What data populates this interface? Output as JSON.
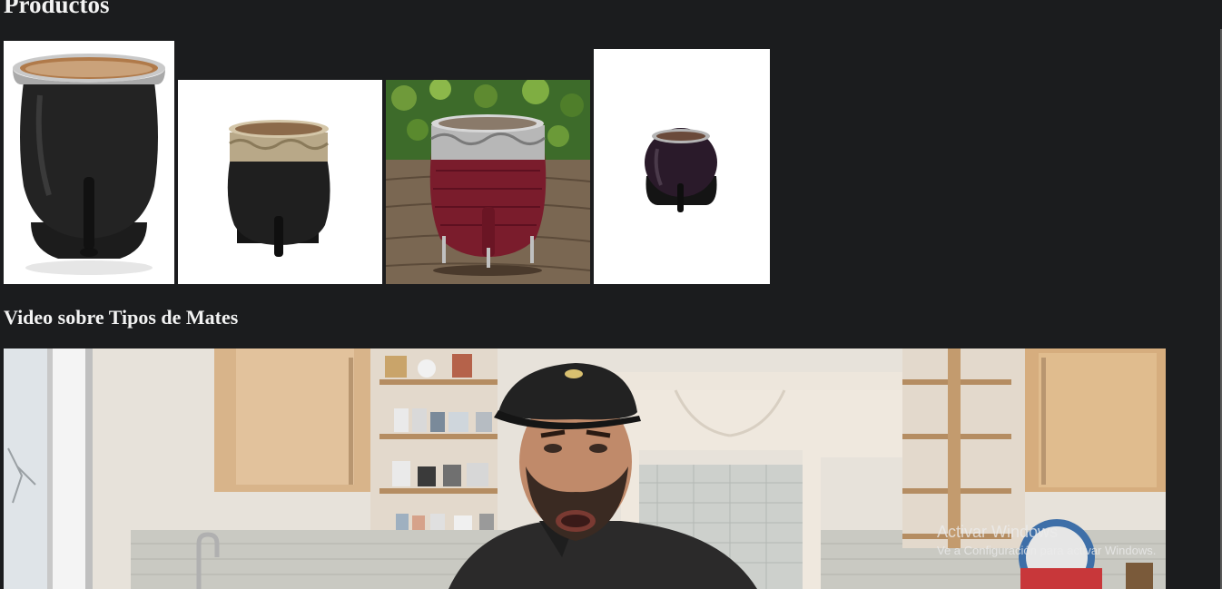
{
  "heading": "Productos",
  "products": [
    {
      "name": "Mate negro de cuero con virola de alpaca",
      "icon": "mate-image"
    },
    {
      "name": "Mate negro con virola cincelada",
      "icon": "mate-image"
    },
    {
      "name": "Mate bordó con patas de alpaca",
      "icon": "mate-image"
    },
    {
      "name": "Mate calabaza negra pequeño",
      "icon": "mate-image"
    }
  ],
  "video_section": {
    "title": "Video sobre Tipos de Mates"
  },
  "watermark": {
    "line1": "Activar Windows",
    "line2": "Ve a Configuración para activar Windows."
  }
}
